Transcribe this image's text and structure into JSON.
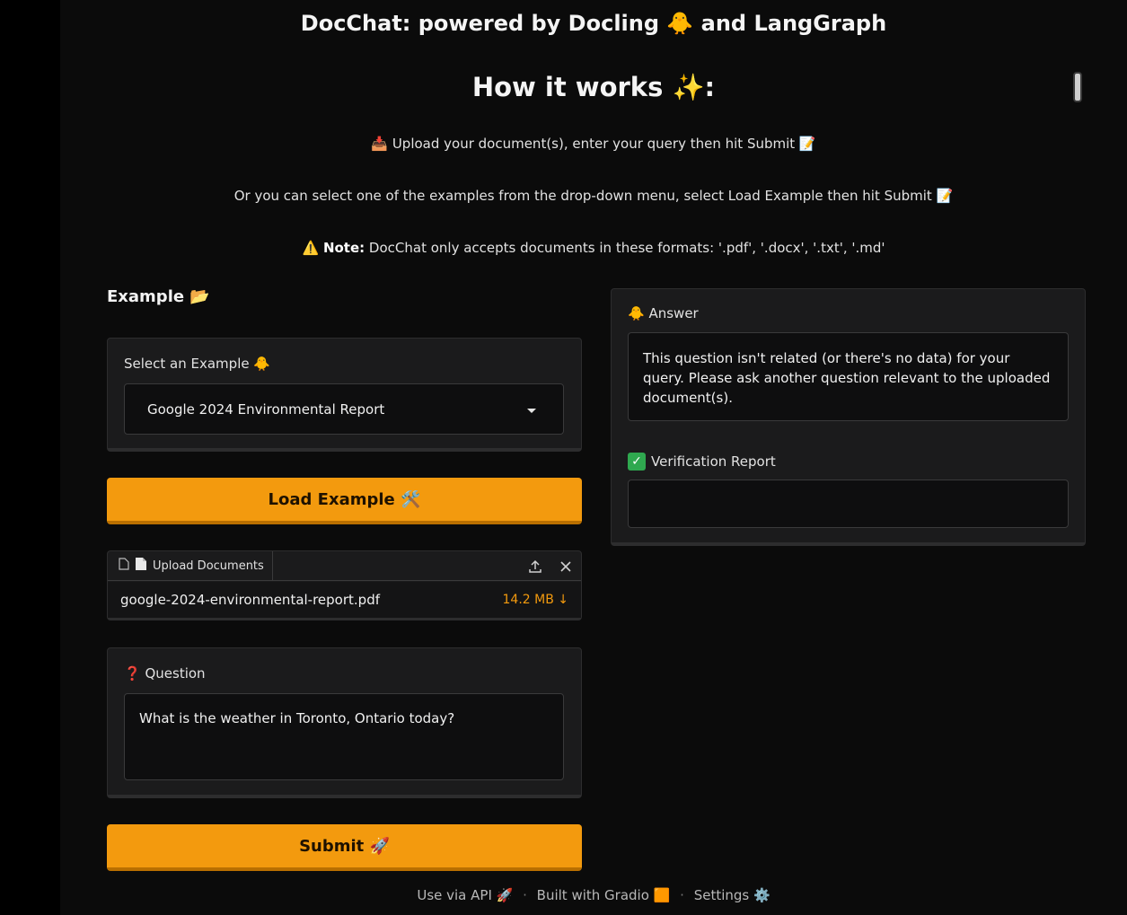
{
  "header": {
    "title": "DocChat: powered by Docling 🐥 and LangGraph",
    "subtitle": "How it works ✨:"
  },
  "instructions": {
    "line1": "📥 Upload your document(s), enter your query then hit Submit 📝",
    "line2": "Or you can select one of the examples from the drop-down menu, select Load Example then hit Submit 📝",
    "note_icon": "⚠️",
    "note_label": "Note:",
    "note_text": "DocChat only accepts documents in these formats: '.pdf', '.docx', '.txt', '.md'"
  },
  "example": {
    "section_label": "Example 📂",
    "select_label": "Select an Example 🐥",
    "selected_value": "Google 2024 Environmental Report",
    "load_button": "Load Example 🛠️"
  },
  "upload": {
    "tab_label": "Upload Documents",
    "file_name": "google-2024-environmental-report.pdf",
    "file_size": "14.2 MB ↓"
  },
  "question": {
    "label": "Question",
    "icon": "❓",
    "value": "What is the weather in Toronto, Ontario today?"
  },
  "submit_button": "Submit 🚀",
  "answer": {
    "label": "Answer",
    "icon": "🐥",
    "text": "This question isn't related (or there's no data) for your query. Please ask another question relevant to the uploaded document(s)."
  },
  "verification": {
    "label": "Verification Report",
    "text": ""
  },
  "footer": {
    "api": "Use via API 🚀",
    "built": "Built with Gradio 🟧",
    "settings": "Settings ⚙️"
  },
  "colors": {
    "accent": "#f39a0e",
    "panel": "#1b1b1c",
    "background": "#0b0b0b"
  }
}
